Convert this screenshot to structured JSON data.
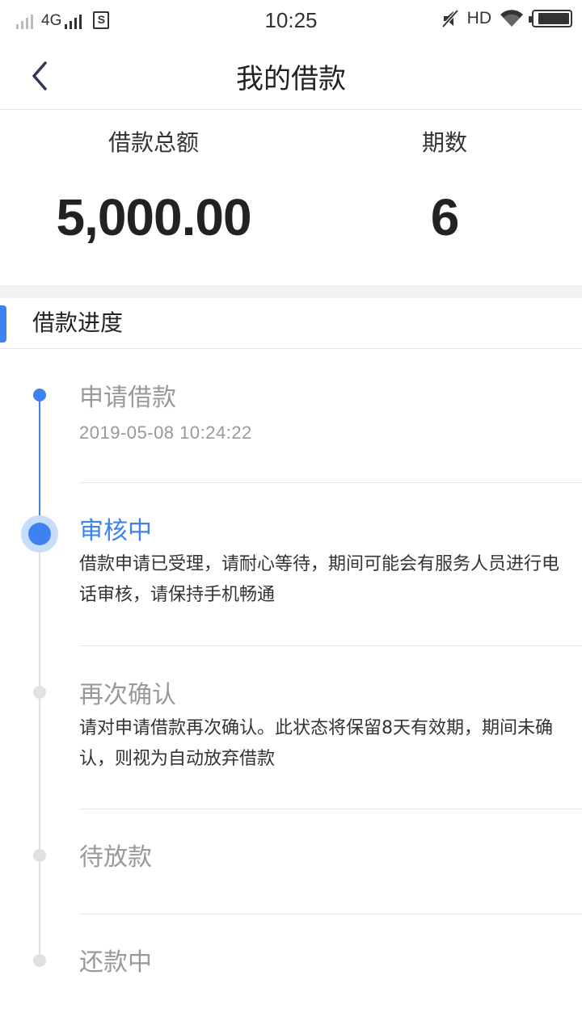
{
  "status_bar": {
    "network": "4G",
    "time": "10:25",
    "hd": "HD",
    "icons": [
      "signal-icon",
      "sim-icon",
      "mute-icon",
      "wifi-icon",
      "battery-icon"
    ]
  },
  "header": {
    "title": "我的借款",
    "back_icon": "chevron-left-icon"
  },
  "summary": {
    "total_label": "借款总额",
    "total_value": "5,000.00",
    "periods_label": "期数",
    "periods_value": "6"
  },
  "progress": {
    "title": "借款进度",
    "steps": [
      {
        "title": "申请借款",
        "time": "2019-05-08 10:24:22",
        "status": "done"
      },
      {
        "title": "审核中",
        "description": "借款申请已受理，请耐心等待，期间可能会有服务人员进行电话审核，请保持手机畅通",
        "status": "active"
      },
      {
        "title": "再次确认",
        "description": "请对申请借款再次确认。此状态将保留8天有效期，期间未确认，则视为自动放弃借款",
        "status": "pending"
      },
      {
        "title": "待放款",
        "status": "pending"
      },
      {
        "title": "还款中",
        "status": "pending"
      }
    ]
  },
  "colors": {
    "accent": "#3d82f0",
    "muted": "#999999",
    "divider": "#e6e6e6"
  }
}
